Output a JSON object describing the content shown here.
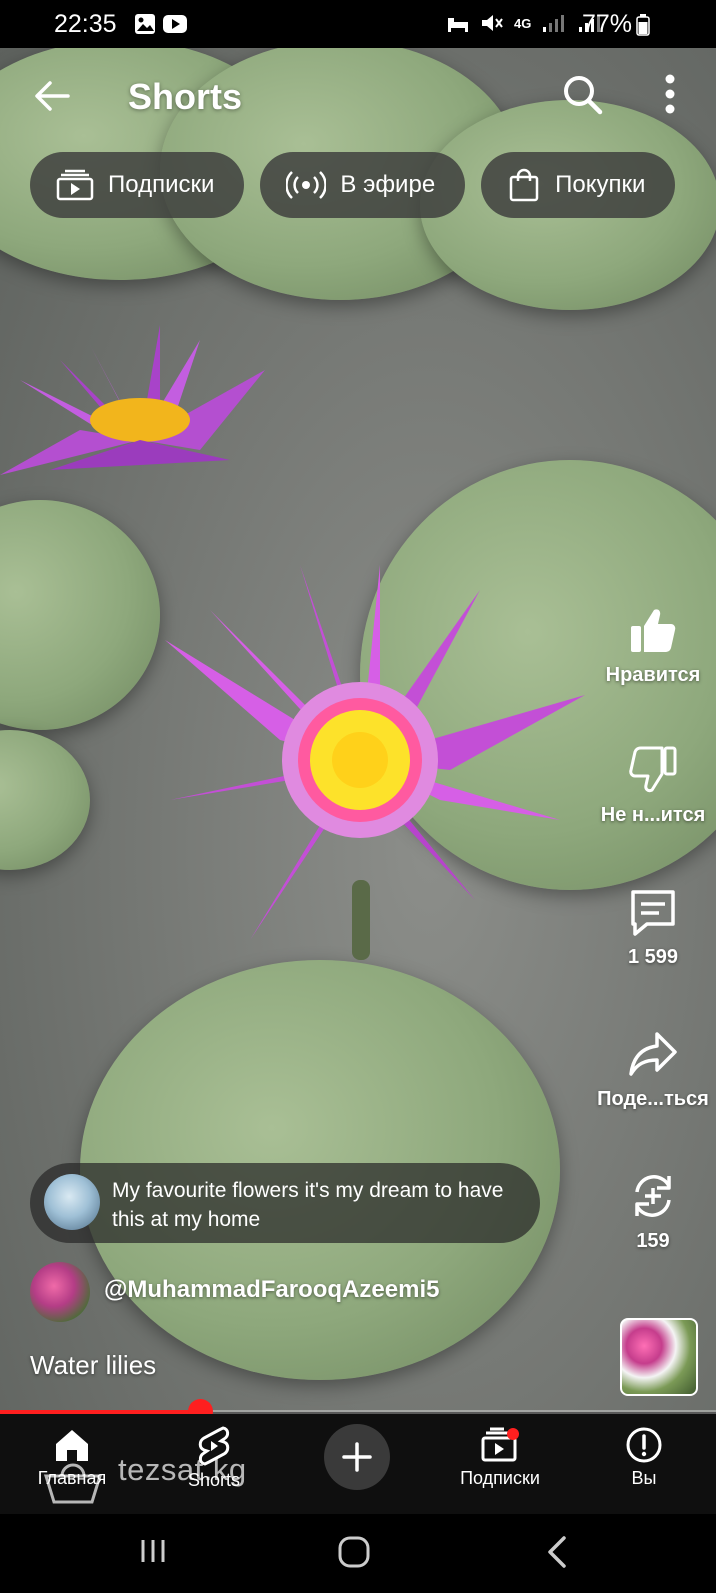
{
  "status_bar": {
    "time": "22:35",
    "network": "4G",
    "battery": "77%"
  },
  "top_bar": {
    "title": "Shorts"
  },
  "chips": [
    {
      "label": "Подписки",
      "icon": "subscriptions-icon"
    },
    {
      "label": "В эфире",
      "icon": "live-icon"
    },
    {
      "label": "Покупки",
      "icon": "shopping-bag-icon"
    }
  ],
  "actions": {
    "like_label": "Нравится",
    "dislike_label": "Не н...ится",
    "comments_count": "1 599",
    "share_label": "Поде...ться",
    "remix_count": "159"
  },
  "comment_preview": {
    "text": "My favourite flowers it's my dream to have this at my home"
  },
  "channel": {
    "handle": "@MuhammadFarooqAzeemi5"
  },
  "video": {
    "title": "Water lilies",
    "progress": 0.28
  },
  "bottom_nav": {
    "home_label": "Главная",
    "shorts_label": "Shorts",
    "subscriptions_label": "Подписки",
    "you_label": "Вы"
  },
  "watermark": "tezsat.kg",
  "colors": {
    "accent_red": "#ff1f1f",
    "chip_bg": "#3c3c3c",
    "nav_bg": "#0f0f0f"
  }
}
